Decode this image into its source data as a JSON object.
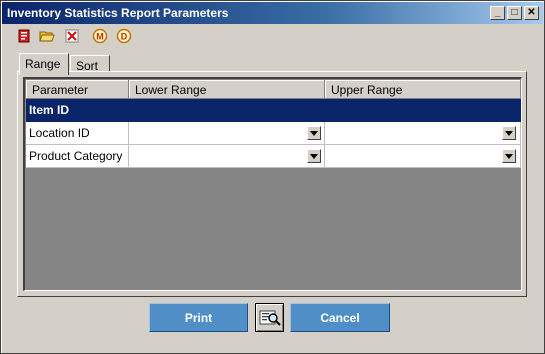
{
  "window": {
    "title": "Inventory Statistics Report Parameters",
    "controls": {
      "minimize": "_",
      "maximize": "□",
      "close": "✕"
    }
  },
  "toolbar": {
    "icons": [
      "report-icon",
      "open-folder-icon",
      "delete-icon",
      "m-circle-icon",
      "d-circle-icon"
    ],
    "m_label": "M",
    "d_label": "D"
  },
  "tabs": [
    {
      "label": "Range",
      "active": true
    },
    {
      "label": "Sort",
      "active": false
    }
  ],
  "grid": {
    "headers": [
      "Parameter",
      "Lower Range",
      "Upper Range"
    ],
    "rows": [
      {
        "parameter": "Item ID",
        "lower": "",
        "upper": "",
        "selected": true
      },
      {
        "parameter": "Location ID",
        "lower": "",
        "upper": "",
        "selected": false
      },
      {
        "parameter": "Product Category",
        "lower": "",
        "upper": "",
        "selected": false
      }
    ]
  },
  "buttons": {
    "print_label": "Print",
    "cancel_label": "Cancel",
    "preview_icon": "print-preview-icon"
  },
  "colors": {
    "button_blue": "#4f8ec6",
    "selected_row": "#0a246a",
    "title_gradient_start": "#0a246a"
  }
}
